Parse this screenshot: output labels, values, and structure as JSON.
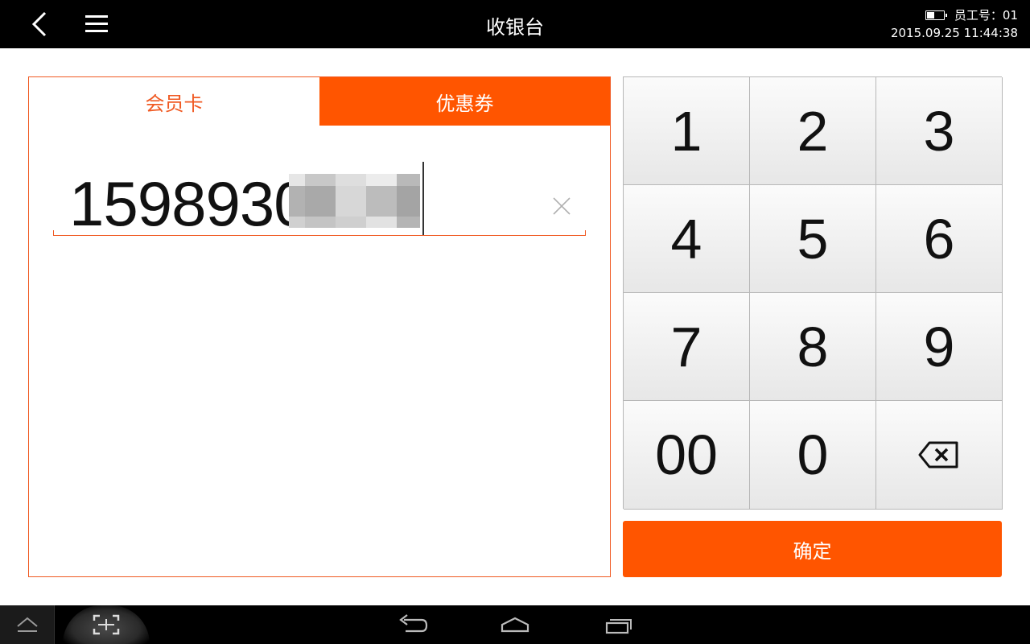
{
  "header": {
    "title": "收银台",
    "employee": "员工号：01",
    "datetime": "2015.09.25 11:44:38",
    "battery_level": 0.45
  },
  "tabs": [
    {
      "label": "会员卡",
      "active": true
    },
    {
      "label": "优惠券",
      "active": false
    }
  ],
  "input": {
    "value": "1598930",
    "masked": true
  },
  "keypad": {
    "keys": [
      "1",
      "2",
      "3",
      "4",
      "5",
      "6",
      "7",
      "8",
      "9",
      "00",
      "0"
    ],
    "backspace_icon": "backspace-icon"
  },
  "confirm_label": "确定",
  "colors": {
    "accent": "#ff5500",
    "accent_border": "#f05a23",
    "bar": "#000000"
  }
}
